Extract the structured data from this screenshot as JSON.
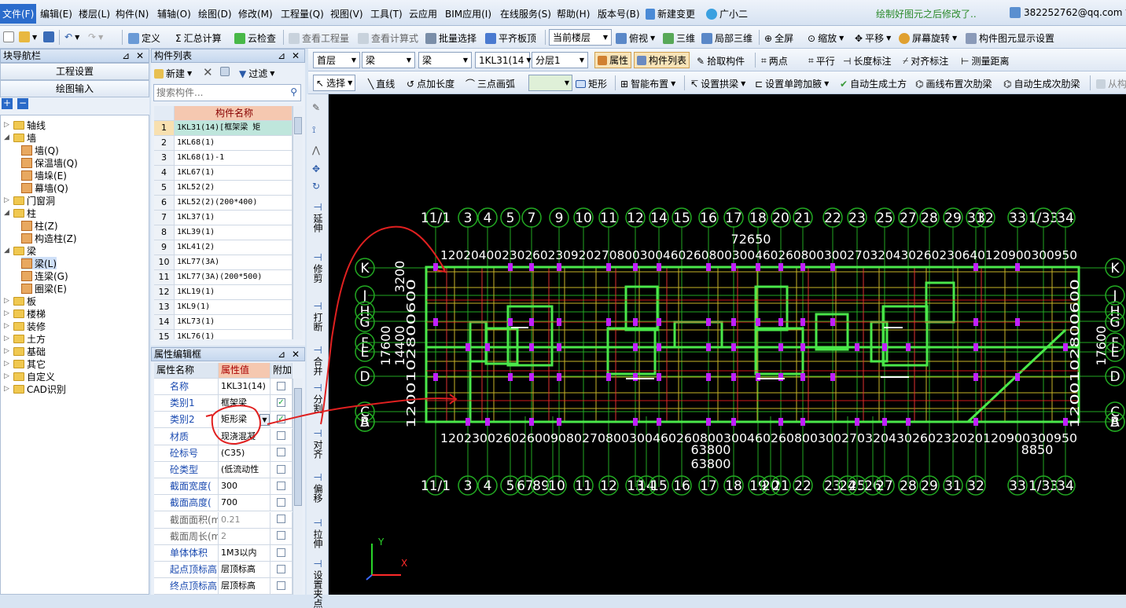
{
  "menu": {
    "items": [
      "文件(F)",
      "编辑(E)",
      "楼层(L)",
      "构件(N)",
      "辅轴(O)",
      "绘图(D)",
      "修改(M)",
      "工程量(Q)",
      "视图(V)",
      "工具(T)",
      "云应用",
      "BIM应用(I)",
      "在线服务(S)",
      "帮助(H)",
      "版本号(B)"
    ],
    "new_change": "新建变更",
    "guang_er": "广小二",
    "notice": "绘制好图元之后修改了..",
    "account": "382252762@qq.com"
  },
  "toolbar1": {
    "define": "定义",
    "sum": "汇总计算",
    "cloud_check": "云检查",
    "view_qty": "查看工程量",
    "view_formula": "查看计算式",
    "batch_select": "批量选择",
    "flat_slab": "平齐板顶",
    "current_floor": "当前楼层",
    "top_view": "俯视",
    "three_d": "三维",
    "local_3d": "局部三维",
    "full_screen": "全屏",
    "zoom": "缩放",
    "pan": "平移",
    "rotate": "屏幕旋转",
    "display_setting": "构件图元显示设置"
  },
  "toolbar2": {
    "floor": "首层",
    "cat1": "梁",
    "cat2": "梁",
    "component": "1KL31(14",
    "layer": "分层1",
    "attr": "属性",
    "comp_list": "构件列表",
    "pick": "拾取构件",
    "two_points": "两点",
    "parallel": "平行",
    "len_mark": "长度标注",
    "align_mark": "对齐标注",
    "measure": "测量距离"
  },
  "toolbar3": {
    "select": "选择",
    "line": "直线",
    "point_len": "点加长度",
    "arc": "三点画弧",
    "rect": "矩形",
    "smart": "智能布置",
    "arch_beam": "设置拱梁",
    "haunch": "设置单跨加腋",
    "auto_earth": "自动生成土方",
    "draw_sub_beam": "画线布置次肋梁",
    "auto_sub_beam": "自动生成次肋梁",
    "from": "从构"
  },
  "nav": {
    "title": "块导航栏",
    "project_settings": "工程设置",
    "draw_input": "绘图输入",
    "tree": [
      {
        "label": "轴线",
        "level": 0,
        "exp": "▷"
      },
      {
        "label": "墙",
        "level": 0,
        "exp": "◢"
      },
      {
        "label": "墙(Q)",
        "level": 1
      },
      {
        "label": "保温墙(Q)",
        "level": 1
      },
      {
        "label": "墙垛(E)",
        "level": 1
      },
      {
        "label": "幕墙(Q)",
        "level": 1
      },
      {
        "label": "门窗洞",
        "level": 0,
        "exp": "▷"
      },
      {
        "label": "柱",
        "level": 0,
        "exp": "◢"
      },
      {
        "label": "柱(Z)",
        "level": 1
      },
      {
        "label": "构造柱(Z)",
        "level": 1
      },
      {
        "label": "梁",
        "level": 0,
        "exp": "◢"
      },
      {
        "label": "梁(L)",
        "level": 1
      },
      {
        "label": "连梁(G)",
        "level": 1
      },
      {
        "label": "圈梁(E)",
        "level": 1
      },
      {
        "label": "板",
        "level": 0,
        "exp": "▷"
      },
      {
        "label": "楼梯",
        "level": 0,
        "exp": "▷"
      },
      {
        "label": "装修",
        "level": 0,
        "exp": "▷"
      },
      {
        "label": "土方",
        "level": 0,
        "exp": "▷"
      },
      {
        "label": "基础",
        "level": 0,
        "exp": "▷"
      },
      {
        "label": "其它",
        "level": 0,
        "exp": "▷"
      },
      {
        "label": "自定义",
        "level": 0,
        "exp": "▷"
      },
      {
        "label": "CAD识别",
        "level": 0,
        "exp": "▷"
      }
    ]
  },
  "comp_list": {
    "title": "构件列表",
    "new": "新建",
    "filter": "过滤",
    "search_placeholder": "搜索构件...",
    "col_name": "构件名称",
    "rows": [
      {
        "n": "1",
        "name": "1KL31(14)[框架梁 矩"
      },
      {
        "n": "2",
        "name": "1KL68(1)"
      },
      {
        "n": "3",
        "name": "1KL68(1)-1"
      },
      {
        "n": "4",
        "name": "1KL67(1)"
      },
      {
        "n": "5",
        "name": "1KL52(2)"
      },
      {
        "n": "6",
        "name": "1KL52(2)(200*400)"
      },
      {
        "n": "7",
        "name": "1KL37(1)"
      },
      {
        "n": "8",
        "name": "1KL39(1)"
      },
      {
        "n": "9",
        "name": "1KL41(2)"
      },
      {
        "n": "10",
        "name": "1KL77(3A)"
      },
      {
        "n": "11",
        "name": "1KL77(3A)(200*500)"
      },
      {
        "n": "12",
        "name": "1KL19(1)"
      },
      {
        "n": "13",
        "name": "1KL9(1)"
      },
      {
        "n": "14",
        "name": "1KL73(1)"
      },
      {
        "n": "15",
        "name": "1KL76(1)"
      }
    ]
  },
  "props": {
    "title": "属性编辑框",
    "col_name": "属性名称",
    "col_value": "属性值",
    "col_extra": "附加",
    "rows": [
      {
        "name": "名称",
        "value": "1KL31(14)",
        "chk": ""
      },
      {
        "name": "类别1",
        "value": "框架梁",
        "chk": "✓"
      },
      {
        "name": "类别2",
        "value": "矩形梁",
        "chk": "✓"
      },
      {
        "name": "材质",
        "value": "现浇混凝",
        "chk": ""
      },
      {
        "name": "砼标号",
        "value": "(C35)",
        "chk": ""
      },
      {
        "name": "砼类型",
        "value": "(低流动性",
        "chk": ""
      },
      {
        "name": "截面宽度(",
        "value": "300",
        "chk": ""
      },
      {
        "name": "截面高度(",
        "value": "700",
        "chk": ""
      },
      {
        "name": "截面面积(m",
        "value": "0.21",
        "chk": ""
      },
      {
        "name": "截面周长(m",
        "value": "2",
        "chk": ""
      },
      {
        "name": "单体体积",
        "value": "1M3以内",
        "chk": ""
      },
      {
        "name": "起点顶标高",
        "value": "层顶标高",
        "chk": ""
      },
      {
        "name": "终点顶标高",
        "value": "层顶标高",
        "chk": ""
      }
    ]
  },
  "vtools": [
    "延伸",
    "修剪",
    "打断",
    "合并",
    "分割",
    "对齐",
    "偏移",
    "拉伸",
    "设置夹点"
  ],
  "drawing": {
    "top_axes": [
      "11/1",
      "3",
      "4",
      "5",
      "7",
      "9",
      "10",
      "11",
      "12",
      "14",
      "15",
      "16",
      "17",
      "18",
      "20",
      "21",
      "22",
      "23",
      "25",
      "27",
      "28",
      "29",
      "31",
      "32",
      "33",
      "1/33",
      "34"
    ],
    "bottom_axes": [
      "11/1",
      "3",
      "4",
      "5",
      "67",
      "89",
      "10",
      "11",
      "12",
      "13",
      "14",
      "15",
      "16",
      "17",
      "18",
      "19",
      "20",
      "21",
      "22",
      "23",
      "24",
      "25",
      "26",
      "27",
      "28",
      "29",
      "31",
      "32",
      "33",
      "1/33",
      "34"
    ],
    "left_axes": [
      "K",
      "J",
      "H",
      "G",
      "F",
      "E",
      "D",
      "C",
      "B",
      "A"
    ],
    "right_axes": [
      "K",
      "J",
      "H",
      "G",
      "F",
      "E",
      "D",
      "C",
      "B",
      "A"
    ],
    "total_width_top": "72650",
    "total_width_bottom1": "63800",
    "total_width_bottom2": "63800",
    "right_partial": "8850",
    "left_total1": "17600",
    "left_total2": "14400",
    "left_dim": "3200",
    "right_total": "17600",
    "dim_top": "12020400230260230920270800300460260800300460260800300270320430260230640120900300950",
    "dim_bottom": "120230026026009080270800300460260800300460260800300270320430260232020120900300950",
    "dim_left": "1200102800600",
    "dim_right": "1200102800600",
    "top_dim_start": "1200",
    "left_dim_side": "1200",
    "axis_y": "Y",
    "axis_x": "X"
  }
}
